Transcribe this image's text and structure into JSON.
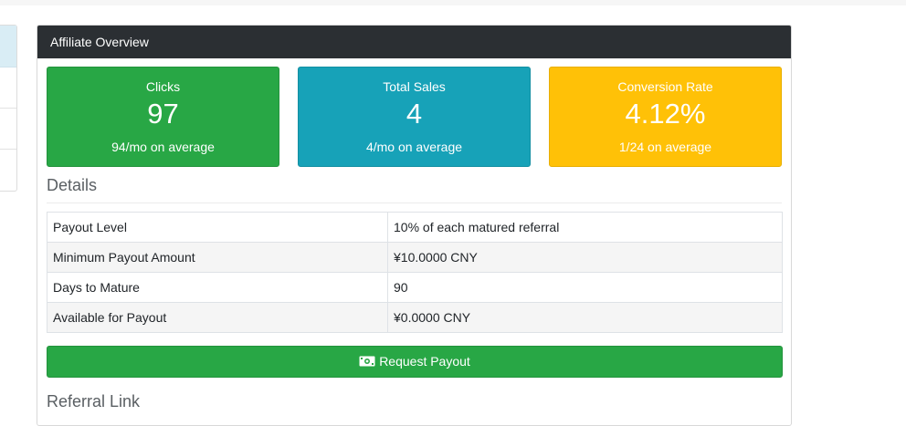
{
  "card": {
    "title": "Affiliate Overview"
  },
  "stats": {
    "clicks": {
      "label": "Clicks",
      "value": "97",
      "sub": "94/mo on average",
      "color": "#28a745"
    },
    "sales": {
      "label": "Total Sales",
      "value": "4",
      "sub": "4/mo on average",
      "color": "#17a2b8"
    },
    "conversion": {
      "label": "Conversion Rate",
      "value": "4.12%",
      "sub": "1/24 on average",
      "color": "#ffc107"
    }
  },
  "details": {
    "title": "Details",
    "rows": [
      {
        "key": "Payout Level",
        "value": "10% of each matured referral"
      },
      {
        "key": "Minimum Payout Amount",
        "value": "¥10.0000 CNY"
      },
      {
        "key": "Days to Mature",
        "value": "90"
      },
      {
        "key": "Available for Payout",
        "value": "¥0.0000 CNY"
      }
    ]
  },
  "payout_button": {
    "label": "Request Payout",
    "icon": "money-bill-icon"
  },
  "referral": {
    "title": "Referral Link"
  }
}
